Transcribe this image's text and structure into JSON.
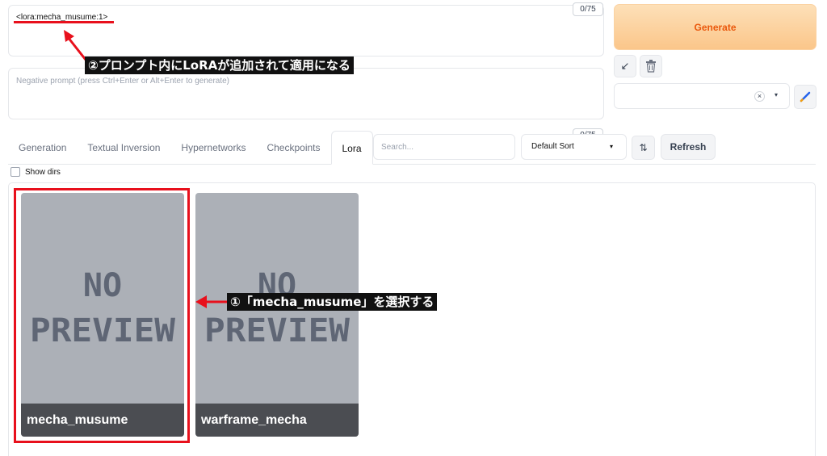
{
  "prompt": {
    "value": "<lora:mecha_musume:1>",
    "token_count": "0/75"
  },
  "negative_prompt": {
    "placeholder": "Negative prompt (press Ctrl+Enter or Alt+Enter to generate)",
    "token_count": "0/75"
  },
  "sidebar": {
    "generate_label": "Generate",
    "arrow_icon": "↙",
    "trash_icon": "🗑",
    "clear_icon": "×",
    "caret_icon": "▾",
    "edit_icon": "✎"
  },
  "tabs": [
    {
      "label": "Generation"
    },
    {
      "label": "Textual Inversion"
    },
    {
      "label": "Hypernetworks"
    },
    {
      "label": "Checkpoints"
    },
    {
      "label": "Lora"
    }
  ],
  "active_tab": "Lora",
  "toolbar": {
    "search_placeholder": "Search...",
    "sort_value": "Default Sort",
    "sort_caret": "▾",
    "order_icon": "⇅",
    "refresh_label": "Refresh"
  },
  "show_dirs": {
    "label": "Show dirs",
    "checked": false
  },
  "cards": [
    {
      "name": "mecha_musume",
      "preview_line1": "NO",
      "preview_line2": "PREVIEW"
    },
    {
      "name": "warframe_mecha",
      "preview_line1": "NO",
      "preview_line2": "PREVIEW"
    }
  ],
  "annotations": {
    "callout_2": "②プロンプト内にLoRAが追加されて適用になる",
    "callout_1": "①「mecha_musume」を選択する",
    "color": "#e8101c"
  },
  "colors": {
    "generate_text": "#ea580c",
    "generate_bg": "#fcd19c",
    "card_bg": "#acb0b7",
    "card_label_bg": "#4b4d52",
    "preview_text": "#5f6675"
  }
}
